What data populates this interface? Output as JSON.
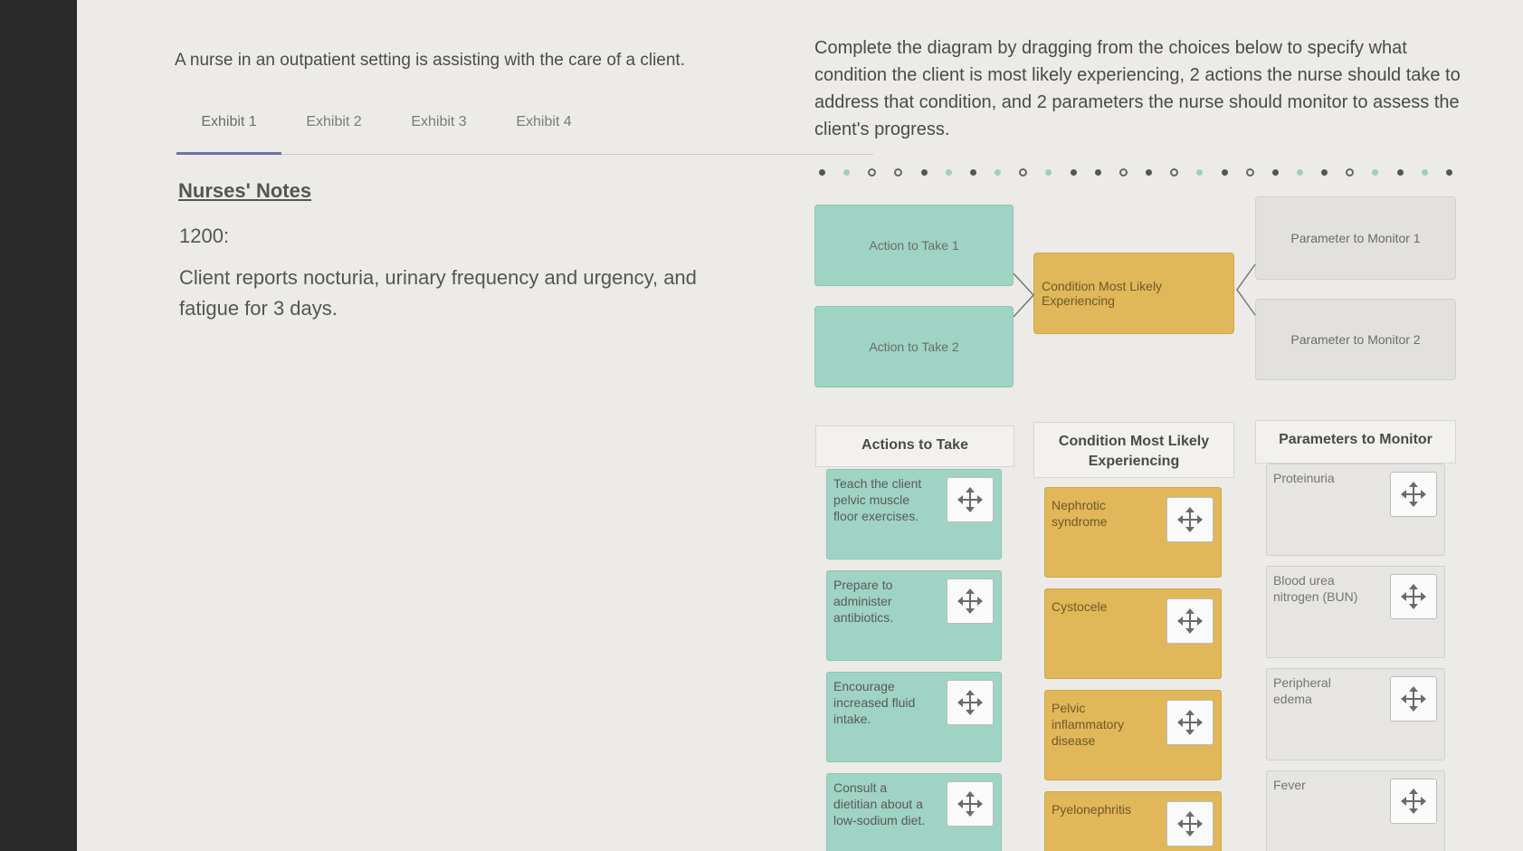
{
  "stem": "A nurse in an outpatient setting is assisting with the care of a client.",
  "tabs": [
    "Exhibit 1",
    "Exhibit 2",
    "Exhibit 3",
    "Exhibit 4"
  ],
  "notes": {
    "title": "Nurses' Notes",
    "time": "1200:",
    "text": "Client reports nocturia, urinary frequency and urgency, and fatigue for 3 days."
  },
  "instructions": "Complete the diagram by dragging from the choices below to specify what condition the client is most likely experiencing, 2 actions the nurse should take to address that condition, and 2 parameters the nurse should monitor to assess the client's progress.",
  "diagram": {
    "action1": "Action to Take 1",
    "action2": "Action to Take 2",
    "condition": "Condition Most Likely Experiencing",
    "param1": "Parameter to Monitor 1",
    "param2": "Parameter to Monitor 2"
  },
  "columns": {
    "actions_title": "Actions to Take",
    "condition_title": "Condition Most Likely Experiencing",
    "params_title": "Parameters to Monitor"
  },
  "actions": [
    "Teach the client pelvic muscle floor exercises.",
    "Prepare to administer antibiotics.",
    "Encourage increased fluid intake.",
    "Consult a dietitian about a low-sodium diet."
  ],
  "conditions": [
    "Nephrotic syndrome",
    "Cystocele",
    "Pelvic inflammatory disease",
    "Pyelonephritis"
  ],
  "parameters": [
    "Proteinuria",
    "Blood urea nitrogen (BUN)",
    "Peripheral edema",
    "Fever"
  ],
  "colors": {
    "action": "#9fd3c4",
    "condition": "#e0b759",
    "parameter": "#e2e1de",
    "tab_active": "#6a74a7"
  }
}
